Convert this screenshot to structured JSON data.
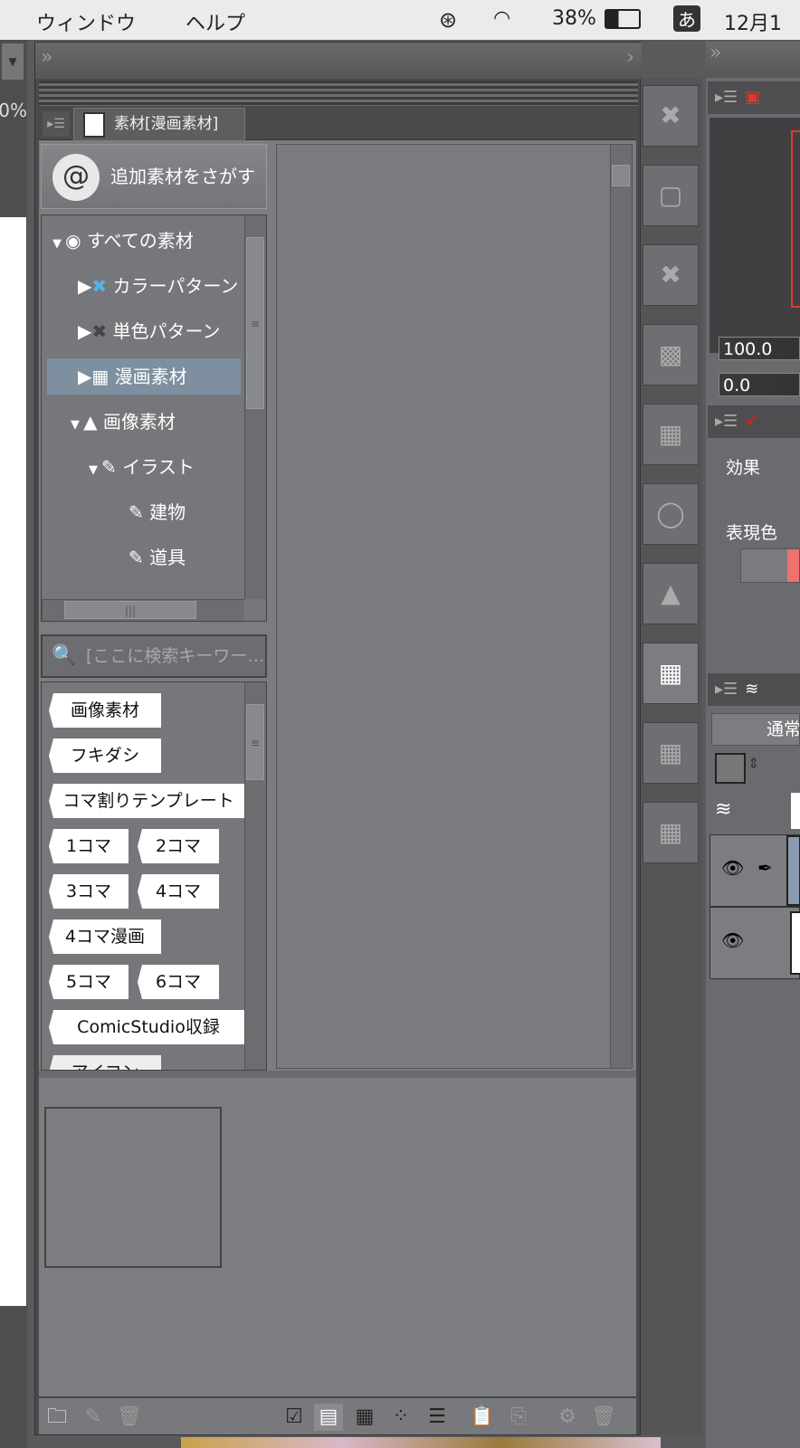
{
  "menubar": {
    "items": [
      "ウィンドウ",
      "ヘルプ"
    ],
    "battery": "38%",
    "ime": "あ",
    "clock": "12月1日"
  },
  "left_strip": {
    "zoom_partial": "0%"
  },
  "material_panel": {
    "tab_title": "素材[漫画素材]",
    "find_button": "追加素材をさがす",
    "tree": [
      {
        "label": "すべての素材",
        "expanded": true
      },
      {
        "label": "カラーパターン",
        "expanded": false
      },
      {
        "label": "単色パターン",
        "expanded": false
      },
      {
        "label": "漫画素材",
        "expanded": false,
        "selected": true
      },
      {
        "label": "画像素材",
        "expanded": true
      },
      {
        "label": "イラスト",
        "expanded": true
      },
      {
        "label": "建物"
      },
      {
        "label": "道具"
      }
    ],
    "search_placeholder": "[ここに検索キーワー…",
    "tags": [
      "画像素材",
      "フキダシ",
      "コマ割りテンプレート",
      "1コマ",
      "2コマ",
      "3コマ",
      "4コマ",
      "4コマ漫画",
      "5コマ",
      "6コマ",
      "ComicStudio収録",
      "アイコン"
    ]
  },
  "right_panel": {
    "opacity_value": "100.0",
    "second_value": "0.0",
    "effect_label": "効果",
    "color_label": "表現色",
    "blend_mode": "通常",
    "accent": "#e03a2a"
  }
}
